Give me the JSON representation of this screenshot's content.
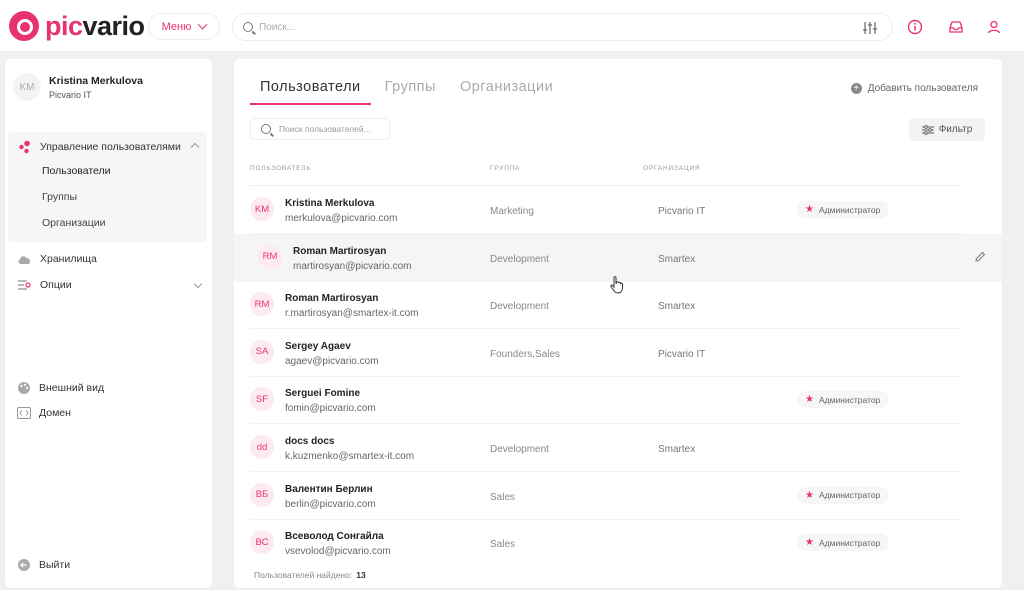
{
  "header": {
    "logo": {
      "prefix": "pic",
      "suffix": "vario"
    },
    "menu_label": "Меню",
    "search_placeholder": "Поиск...",
    "icons": [
      "sliders-icon",
      "info-icon",
      "inbox-icon",
      "user-icon"
    ]
  },
  "sidebar": {
    "profile": {
      "initials": "KM",
      "name": "Kristina Merkulova",
      "org": "Picvario IT"
    },
    "user_management": {
      "label": "Управление пользователями",
      "items": [
        {
          "label": "Пользователи",
          "active": true
        },
        {
          "label": "Группы"
        },
        {
          "label": "Организации"
        }
      ]
    },
    "storage": "Хранилища",
    "options": "Опции",
    "appearance": "Внешний вид",
    "domain": "Домен",
    "logout": "Выйти"
  },
  "main": {
    "tabs": [
      {
        "label": "Пользователи",
        "active": true
      },
      {
        "label": "Группы"
      },
      {
        "label": "Организации"
      }
    ],
    "add_user_label": "Добавить пользователя",
    "search_placeholder": "Поиск пользователей...",
    "filter_label": "Фильтр",
    "columns": [
      "ПОЛЬЗОВАТЕЛЬ",
      "ГРУППА",
      "ОРГАНИЗАЦИЯ"
    ],
    "rows": [
      {
        "initials": "KM",
        "name": "Kristina Merkulova",
        "email": "merkulova@picvario.com",
        "group": "Marketing",
        "org": "Picvario IT",
        "badge": "Администратор"
      },
      {
        "initials": "RM",
        "name": "Roman Martirosyan",
        "email": "martirosyan@picvario.com",
        "group": "Development",
        "org": "Smartex",
        "badge": "",
        "hover": true
      },
      {
        "initials": "RM",
        "name": "Roman Martirosyan",
        "email": "r.martirosyan@smartex-it.com",
        "group": "Development",
        "org": "Smartex",
        "badge": ""
      },
      {
        "initials": "SA",
        "name": "Sergey Agaev",
        "email": "agaev@picvario.com",
        "group": "Founders,Sales",
        "org": "Picvario IT",
        "badge": ""
      },
      {
        "initials": "SF",
        "name": "Serguei Fomine",
        "email": "fomin@picvario.com",
        "group": "",
        "org": "",
        "badge": "Администратор"
      },
      {
        "initials": "dd",
        "name": "docs docs",
        "email": "k.kuzmenko@smartex-it.com",
        "group": "Development",
        "org": "Smartex",
        "badge": ""
      },
      {
        "initials": "ВБ",
        "name": "Валентин Берлин",
        "email": "berlin@picvario.com",
        "group": "Sales",
        "org": "",
        "badge": "Администратор"
      },
      {
        "initials": "ВС",
        "name": "Всеволод Сонгайла",
        "email": "vsevolod@picvario.com",
        "group": "Sales",
        "org": "",
        "badge": "Администратор"
      }
    ],
    "found_label": "Пользователей найдено:",
    "found_count": "13"
  },
  "colors": {
    "accent": "#e8346e",
    "avatar_bg": "#fde9f0",
    "page_bg": "#f0f0f2"
  }
}
